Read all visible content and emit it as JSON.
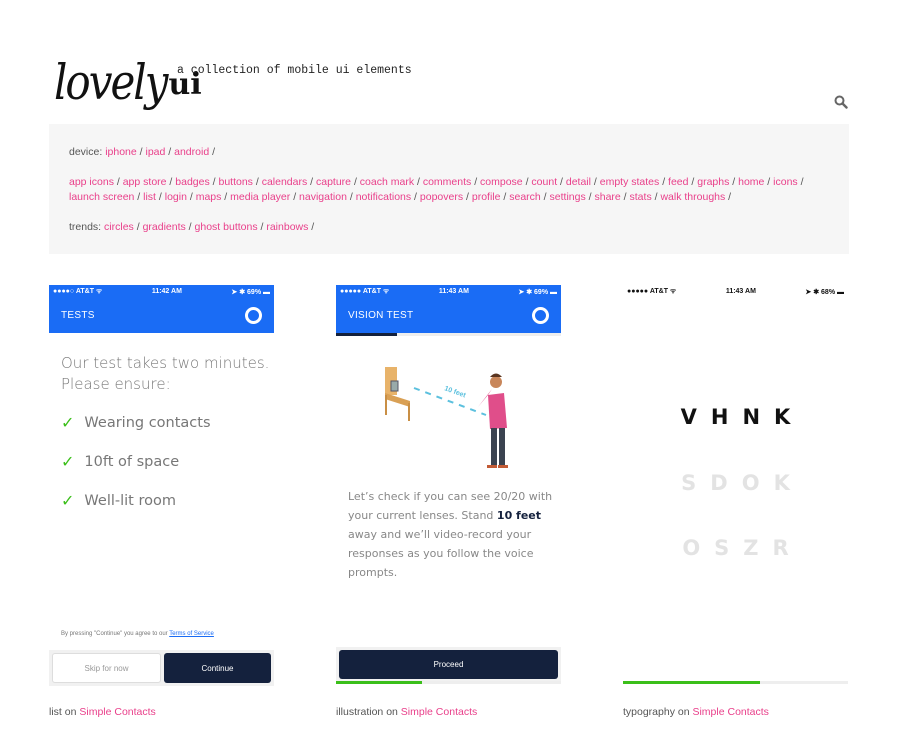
{
  "header": {
    "logo_script": "lovely",
    "logo_bold": "ui",
    "tagline": "a collection of mobile ui elements",
    "search_icon": "search-icon"
  },
  "filters": {
    "device_label": "device:",
    "devices": [
      "iphone",
      "ipad",
      "android"
    ],
    "categories": [
      "app icons",
      "app store",
      "badges",
      "buttons",
      "calendars",
      "capture",
      "coach mark",
      "comments",
      "compose",
      "count",
      "detail",
      "empty states",
      "feed",
      "graphs",
      "home",
      "icons",
      "launch screen",
      "list",
      "login",
      "maps",
      "media player",
      "navigation",
      "notifications",
      "popovers",
      "profile",
      "search",
      "settings",
      "share",
      "stats",
      "walk throughs"
    ],
    "trends_label": "trends:",
    "trends": [
      "circles",
      "gradients",
      "ghost buttons",
      "rainbows"
    ],
    "separator": "/"
  },
  "colors": {
    "link": "#e93f8a",
    "nav_blue": "#1a6cf5",
    "navy": "#14213d",
    "green": "#3bbf1a"
  },
  "cards": [
    {
      "status": {
        "carrier": "●●●●○ AT&T ᯤ",
        "time": "11:42 AM",
        "battery": "➤ ✱ 69% ▬"
      },
      "nav_title": "TESTS",
      "intro": [
        "Our test takes two minutes.",
        "Please ensure:"
      ],
      "checklist": [
        "Wearing contacts",
        "10ft of space",
        "Well-lit room"
      ],
      "check_glyph": "✓",
      "terms_prefix": "By pressing \"Continue\" you agree to our ",
      "terms_link": "Terms of Service",
      "skip_label": "Skip for now",
      "continue_label": "Continue",
      "caption_prefix": "list on ",
      "caption_link": "Simple Contacts"
    },
    {
      "status": {
        "carrier": "●●●●● AT&T ᯤ",
        "time": "11:43 AM",
        "battery": "➤ ✱ 69% ▬"
      },
      "nav_title": "VISION TEST",
      "illustration_label": "10 feet",
      "body_pre": "Let’s check if you can see 20/20 with your current lenses. Stand ",
      "body_bold": "10 feet",
      "body_post": " away and we’ll video-record your responses as you follow the voice prompts.",
      "proceed_label": "Proceed",
      "progress": 0.38,
      "tab_progress": 0.27,
      "caption_prefix": "illustration on ",
      "caption_link": "Simple Contacts"
    },
    {
      "status": {
        "carrier": "●●●●● AT&T ᯤ",
        "time": "11:43 AM",
        "battery": "➤ ✱ 68% ▬"
      },
      "rows": [
        "VHNK",
        "SDOK",
        "OSZR"
      ],
      "progress": 0.61,
      "caption_prefix": "typography on ",
      "caption_link": "Simple Contacts"
    }
  ]
}
